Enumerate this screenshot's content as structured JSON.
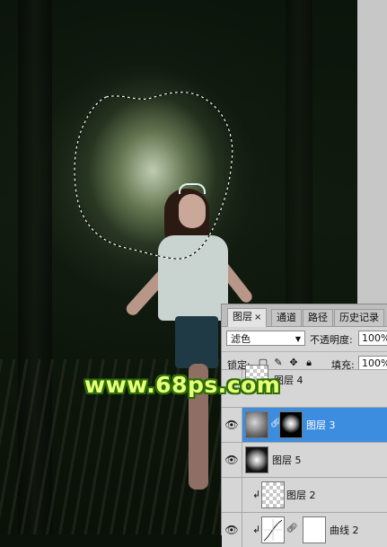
{
  "watermark": "www.68ps.com",
  "layers_panel": {
    "tabs": [
      {
        "label": "图层",
        "close": "×",
        "active": true
      },
      {
        "label": "通道",
        "active": false
      },
      {
        "label": "路径",
        "active": false
      },
      {
        "label": "历史记录",
        "active": false
      }
    ],
    "blend_mode": "滤色",
    "opacity_label": "不透明度:",
    "opacity_value": "100%",
    "lock_label": "锁定:",
    "fill_label": "填充:",
    "fill_value": "100%",
    "layers": [
      {
        "name": "图层 4",
        "visible": false,
        "selected": false
      },
      {
        "name": "图层 3",
        "visible": true,
        "selected": true
      },
      {
        "name": "图层 5",
        "visible": true,
        "selected": false
      },
      {
        "name": "图层 2",
        "visible": false,
        "selected": false,
        "clipped": true
      },
      {
        "name": "曲线 2",
        "visible": true,
        "selected": false,
        "clipped": true
      }
    ]
  },
  "colors": {
    "selection_highlight": "#3c8ddf",
    "watermark_fill": "#e7ff7a",
    "watermark_outline": "#2d6d07"
  },
  "icons": {
    "visibility": "eye-icon",
    "link": "chain-link-icon",
    "clip": "clipping-arrow-icon",
    "lock_transparent": "lock-transparent-pixels-icon",
    "lock_image": "brush-icon",
    "lock_position": "move-icon",
    "lock_all": "padlock-icon"
  }
}
